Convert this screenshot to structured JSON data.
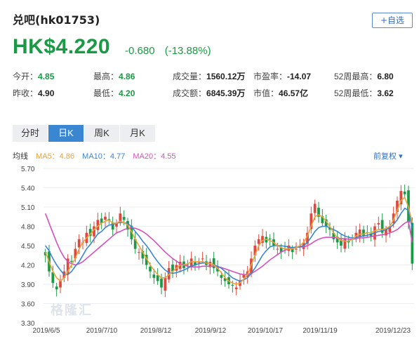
{
  "header": {
    "title": "兑吧(hk01753)",
    "follow_label": "+自选"
  },
  "quote": {
    "price": "HK$4.220",
    "change": "-0.680",
    "change_pct": "(-13.88%)",
    "color": "#1a9a45"
  },
  "stats": [
    {
      "label": "今开：",
      "value": "4.85",
      "green": true
    },
    {
      "label": "最高：",
      "value": "4.86",
      "green": true
    },
    {
      "label": "成交量：",
      "value": "1560.12万",
      "green": false
    },
    {
      "label": "市盈率：",
      "value": "-14.07",
      "green": false
    },
    {
      "label": "52周最高：",
      "value": "6.80",
      "green": false
    },
    {
      "label": "昨收：",
      "value": "4.90",
      "green": false
    },
    {
      "label": "最低：",
      "value": "4.20",
      "green": true
    },
    {
      "label": "成交额：",
      "value": "6845.39万",
      "green": false
    },
    {
      "label": "市值：",
      "value": "46.57亿",
      "green": false
    },
    {
      "label": "52周最低：",
      "value": "3.62",
      "green": false
    }
  ],
  "tabs": [
    "分时",
    "日K",
    "周K",
    "月K"
  ],
  "active_tab": 1,
  "indicators": {
    "label": "均线",
    "ma5": "MA5：4.86",
    "ma10": "MA10：4.77",
    "ma20": "MA20：4.55",
    "ma5_color": "#e8a33c",
    "ma10_color": "#3a86d1",
    "ma20_color": "#d64fbf"
  },
  "adjust": "前复权",
  "watermark": "格隆汇",
  "chart_data": {
    "type": "candlestick",
    "y_ticks": [
      "5.70",
      "5.40",
      "5.10",
      "4.80",
      "4.50",
      "4.20",
      "3.90",
      "3.60",
      "3.30"
    ],
    "ylim": [
      3.3,
      5.7
    ],
    "x_tick_labels": [
      "2019/6/5",
      "2019/7/10",
      "2019/8/12",
      "2019/9/12",
      "2019/10/17",
      "2019/11/19",
      "2019/12/23"
    ],
    "up_color": "#e0483e",
    "down_color": "#1a9a45",
    "closes": [
      4.35,
      4.1,
      3.92,
      3.82,
      3.95,
      4.1,
      4.3,
      4.25,
      4.45,
      4.6,
      4.55,
      4.7,
      4.65,
      4.8,
      4.9,
      4.85,
      4.95,
      4.9,
      4.75,
      4.85,
      5.0,
      4.9,
      4.75,
      4.6,
      4.45,
      4.4,
      4.3,
      4.2,
      4.1,
      4.0,
      3.95,
      3.85,
      4.0,
      4.15,
      4.1,
      4.2,
      4.25,
      4.15,
      4.2,
      4.3,
      4.2,
      4.25,
      4.3,
      4.2,
      4.25,
      4.15,
      4.1,
      4.0,
      3.95,
      3.9,
      3.88,
      3.85,
      3.95,
      4.05,
      4.1,
      4.3,
      4.5,
      4.6,
      4.65,
      4.55,
      4.6,
      4.5,
      4.45,
      4.4,
      4.45,
      4.5,
      4.4,
      4.45,
      4.5,
      4.55,
      4.7,
      5.0,
      5.15,
      4.95,
      4.85,
      4.8,
      4.75,
      4.6,
      4.55,
      4.5,
      4.6,
      4.55,
      4.6,
      4.7,
      4.75,
      4.65,
      4.7,
      4.65,
      4.8,
      4.85,
      4.7,
      4.75,
      4.8,
      5.0,
      5.2,
      5.35,
      5.3,
      4.86,
      4.22
    ],
    "ma5": [
      4.4,
      4.25,
      4.1,
      4.0,
      3.95,
      4.0,
      4.1,
      4.2,
      4.3,
      4.45,
      4.55,
      4.62,
      4.68,
      4.75,
      4.8,
      4.85,
      4.88,
      4.9,
      4.85,
      4.85,
      4.88,
      4.86,
      4.82,
      4.72,
      4.6,
      4.5,
      4.4,
      4.3,
      4.2,
      4.12,
      4.05,
      4.0,
      4.0,
      4.05,
      4.1,
      4.15,
      4.2,
      4.2,
      4.22,
      4.25,
      4.25,
      4.25,
      4.25,
      4.23,
      4.22,
      4.2,
      4.15,
      4.08,
      4.0,
      3.95,
      3.92,
      3.9,
      3.92,
      3.98,
      4.05,
      4.2,
      4.35,
      4.5,
      4.58,
      4.6,
      4.58,
      4.55,
      4.5,
      4.47,
      4.45,
      4.45,
      4.45,
      4.47,
      4.5,
      4.55,
      4.65,
      4.8,
      4.95,
      4.98,
      4.95,
      4.88,
      4.8,
      4.7,
      4.62,
      4.58,
      4.57,
      4.57,
      4.6,
      4.65,
      4.68,
      4.68,
      4.7,
      4.7,
      4.73,
      4.75,
      4.75,
      4.77,
      4.8,
      4.9,
      5.05,
      5.2,
      5.25,
      5.1,
      4.86
    ],
    "ma10": [
      4.5,
      4.42,
      4.3,
      4.2,
      4.12,
      4.05,
      4.05,
      4.1,
      4.18,
      4.25,
      4.35,
      4.45,
      4.52,
      4.6,
      4.68,
      4.72,
      4.78,
      4.82,
      4.83,
      4.85,
      4.86,
      4.86,
      4.84,
      4.8,
      4.72,
      4.65,
      4.57,
      4.5,
      4.42,
      4.33,
      4.25,
      4.18,
      4.12,
      4.08,
      4.07,
      4.08,
      4.1,
      4.12,
      4.15,
      4.18,
      4.2,
      4.22,
      4.23,
      4.23,
      4.22,
      4.2,
      4.18,
      4.15,
      4.1,
      4.05,
      4.0,
      3.97,
      3.95,
      3.97,
      4.0,
      4.07,
      4.15,
      4.25,
      4.35,
      4.42,
      4.48,
      4.5,
      4.5,
      4.5,
      4.49,
      4.48,
      4.47,
      4.47,
      4.48,
      4.5,
      4.55,
      4.63,
      4.72,
      4.78,
      4.8,
      4.8,
      4.78,
      4.75,
      4.72,
      4.68,
      4.65,
      4.63,
      4.62,
      4.63,
      4.64,
      4.65,
      4.66,
      4.68,
      4.7,
      4.72,
      4.73,
      4.75,
      4.78,
      4.83,
      4.9,
      5.0,
      5.08,
      5.05,
      4.77
    ],
    "ma20": [
      5.0,
      4.85,
      4.7,
      4.55,
      4.42,
      4.32,
      4.25,
      4.22,
      4.2,
      4.22,
      4.25,
      4.3,
      4.35,
      4.4,
      4.45,
      4.5,
      4.55,
      4.6,
      4.65,
      4.7,
      4.72,
      4.75,
      4.77,
      4.78,
      4.77,
      4.75,
      4.72,
      4.68,
      4.63,
      4.58,
      4.52,
      4.46,
      4.4,
      4.35,
      4.3,
      4.26,
      4.22,
      4.2,
      4.18,
      4.17,
      4.17,
      4.17,
      4.18,
      4.18,
      4.18,
      4.18,
      4.17,
      4.16,
      4.14,
      4.12,
      4.1,
      4.08,
      4.06,
      4.05,
      4.05,
      4.07,
      4.1,
      4.14,
      4.18,
      4.23,
      4.28,
      4.32,
      4.36,
      4.4,
      4.43,
      4.45,
      4.47,
      4.48,
      4.48,
      4.48,
      4.5,
      4.53,
      4.57,
      4.6,
      4.62,
      4.63,
      4.63,
      4.63,
      4.62,
      4.61,
      4.61,
      4.6,
      4.6,
      4.61,
      4.62,
      4.62,
      4.63,
      4.64,
      4.65,
      4.66,
      4.67,
      4.68,
      4.7,
      4.72,
      4.75,
      4.8,
      4.85,
      4.88,
      4.55
    ]
  }
}
